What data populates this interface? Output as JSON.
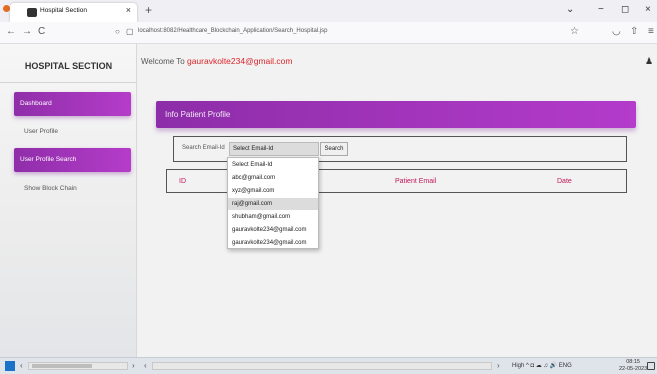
{
  "browser": {
    "tab_title": "Hospital Section",
    "tab_close": "×",
    "new_tab": "+",
    "url": "localhost:8082/Healthcare_Blockchain_Application/Search_Hospital.jsp",
    "back_icon": "←",
    "forward_icon": "→",
    "reload_icon": "C",
    "shield_icon": "○",
    "page_icon": "▢",
    "star_icon": "☆",
    "pocket_icon": "◡",
    "share_icon": "⇧",
    "menu_icon": "≡",
    "minimize": "−",
    "maximize": "◻",
    "close": "×",
    "tablist": "⌄"
  },
  "sidebar": {
    "brand": "HOSPITAL SECTION",
    "items": [
      {
        "label": "Dashboard"
      },
      {
        "label": "User Profile"
      },
      {
        "label": "User Profile Search"
      },
      {
        "label": "Show Block Chain"
      }
    ]
  },
  "header": {
    "welcome_prefix": "Welcome To",
    "email": "gauravkolte234@gmail.com",
    "user_icon": "♟"
  },
  "card": {
    "title": "Info Patient Profile"
  },
  "search": {
    "label": "Search Email-Id",
    "selected": "Select Email-Id",
    "button": "Search",
    "options": [
      "Select Email-Id",
      "abc@gmail.com",
      "xyz@gmail.com",
      "raj@gmail.com",
      "shubham@gmail.com",
      "gauravkolte234@gmail.com",
      "gauravkolte234@gmail.com"
    ]
  },
  "table": {
    "headers": [
      "ID",
      "Patient Email",
      "Date"
    ]
  },
  "taskbar": {
    "tray": "^ ◘ ☁ ♫ 🔊 ENG",
    "time": "08:15",
    "date": "22-05-2023",
    "scroll_left": "‹",
    "scroll_right": "›",
    "high": "High"
  },
  "colors": {
    "accent_purple": "#a235bb",
    "email_red": "#d9252a",
    "table_header_pink": "#c2185b"
  }
}
